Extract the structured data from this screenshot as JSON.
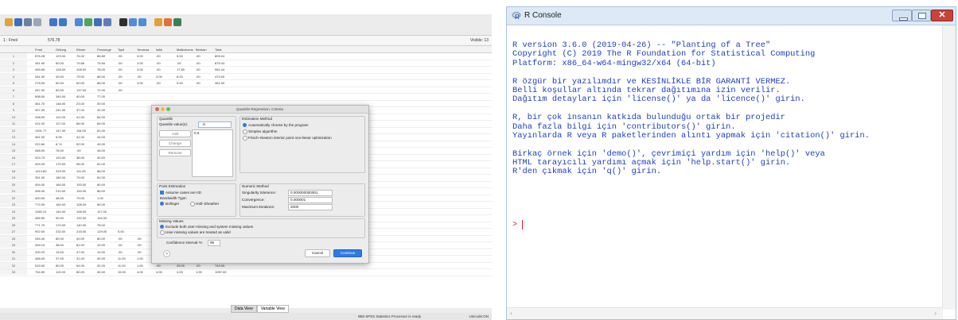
{
  "spss": {
    "cell_ref": "1 : Fmol",
    "cell_value": "576.78",
    "visible_label": "Visible: 13",
    "columns": [
      "Fmol",
      "Ortlong",
      "Ekmer",
      "Ferculuge",
      "Topli",
      "Yenucsa",
      "Isikk",
      "Matkohoms",
      "Benkan",
      "Total"
    ],
    "rows": [
      [
        "1",
        "576.28",
        "129.94",
        "76.02",
        "86.80",
        ".00",
        "3.00",
        ".00",
        "5.00",
        ".00",
        "805.04"
      ],
      [
        "2",
        "451.90",
        "60.00",
        "79.86",
        "75.84",
        ".00",
        "3.00",
        ".00",
        ".00",
        ".00",
        "875.44"
      ],
      [
        "3",
        "459.65",
        "128.00",
        "108.00",
        "78.00",
        ".00",
        "3.00",
        ".00",
        "17.80",
        ".00",
        "981.44"
      ],
      [
        "4",
        "261.00",
        "40.00",
        "79.00",
        "86.00",
        ".00",
        ".00",
        "3.00",
        "8.00",
        ".00",
        "473.00"
      ],
      [
        "5",
        "278.00",
        "60.00",
        "60.00",
        "68.00",
        ".00",
        "3.00",
        ".00",
        "5.00",
        ".00",
        "461.00"
      ],
      [
        "6",
        "267.00",
        "60.00",
        "137.00",
        "72.00",
        ".00",
        "",
        "",
        "",
        "",
        ""
      ],
      [
        "7",
        "598.00",
        "340.00",
        "90.00",
        "77.00",
        "",
        "",
        "",
        "",
        "",
        ""
      ],
      [
        "8",
        "361.70",
        "148.00",
        "23.00",
        "50.00",
        "",
        "",
        "",
        "",
        "",
        ""
      ],
      [
        "9",
        "307.30",
        "241.00",
        "37.00",
        "32.00",
        "",
        "",
        "",
        "",
        "",
        ""
      ],
      [
        "10",
        "438.00",
        "112.00",
        "41.00",
        "84.00",
        "",
        "",
        "",
        "",
        "",
        ""
      ],
      [
        "11",
        "411.00",
        "117.00",
        "86.00",
        "84.00",
        "",
        "",
        "",
        "",
        "",
        ""
      ],
      [
        "12",
        "1301.77",
        "147.00",
        "116.00",
        "81.00",
        "",
        "",
        "",
        "",
        "",
        ""
      ],
      [
        "13",
        "461.00",
        "6.00",
        "41.00",
        "44.00",
        "",
        "",
        "",
        "",
        "",
        ""
      ],
      [
        "14",
        "222.60",
        "6.74",
        "52.00",
        "40.00",
        "",
        "",
        "",
        "",
        "",
        ""
      ],
      [
        "15",
        "468.00",
        "78.00",
        ".00",
        "46.00",
        "",
        "",
        "",
        "",
        "",
        ""
      ],
      [
        "16",
        "324.70",
        "120.00",
        "38.00",
        "40.00",
        "",
        "",
        "",
        "",
        "",
        ""
      ],
      [
        "17",
        "409.25",
        "170.00",
        "96.00",
        "81.00",
        "",
        "",
        "",
        "",
        "",
        ""
      ],
      [
        "18",
        "1414.80",
        "319.00",
        "111.00",
        "88.00",
        "",
        "",
        "",
        "",
        "",
        ""
      ],
      [
        "19",
        "351.00",
        "180.00",
        "79.00",
        "81.00",
        "",
        "",
        "",
        "",
        "",
        ""
      ],
      [
        "20",
        "454.00",
        "160.00",
        "193.00",
        "80.00",
        "",
        "",
        "",
        "",
        "",
        ""
      ],
      [
        "21",
        "396.40",
        "210.00",
        "100.00",
        "86.00",
        "",
        "",
        "",
        "",
        "",
        ""
      ],
      [
        "22",
        "400.00",
        "48.00",
        "79.00",
        "1.00",
        "",
        "",
        "",
        "",
        "",
        ""
      ],
      [
        "23",
        "772.00",
        "160.00",
        "108.00",
        "80.00",
        "",
        "",
        "",
        "",
        "",
        ""
      ],
      [
        "24",
        "1158.10",
        "140.00",
        "106.00",
        "117.00",
        "",
        "",
        "",
        "",
        "",
        ""
      ],
      [
        "25",
        "485.50",
        "90.00",
        "132.00",
        "104.00",
        "",
        "",
        "",
        "",
        "",
        ""
      ],
      [
        "26",
        "771.70",
        "170.00",
        "140.00",
        "75.00",
        "",
        "",
        "",
        "",
        "",
        ""
      ],
      [
        "27",
        "902.00",
        "232.00",
        "215.00",
        "129.00",
        "5.00",
        "",
        "",
        "",
        "",
        "963.00"
      ],
      [
        "28",
        "345.40",
        "80.00",
        "40.00",
        "80.00",
        ".00",
        ".00",
        ".00",
        "4.00",
        ".00",
        "413.40"
      ],
      [
        "29",
        "269.10",
        "38.00",
        "81.00",
        "10.00",
        ".00",
        ".00",
        ".00",
        ".00",
        ".00",
        "448.02"
      ],
      [
        "30",
        "200.20",
        "13.00",
        "47.00",
        "10.00",
        ".00",
        ".00",
        ".00",
        "40.00",
        ".00",
        "341.20"
      ],
      [
        "31",
        "468.00",
        "37.00",
        "31.00",
        "40.00",
        "11.00",
        "1.00",
        ".00",
        ".00",
        ".00",
        "581.20"
      ],
      [
        "32",
        "515.00",
        "80.00",
        "54.00",
        "52.00",
        "11.00",
        "1.00",
        ".00",
        "25.00",
        ".00",
        "743.00"
      ],
      [
        "33",
        "754.50",
        "113.00",
        "80.00",
        "40.00",
        "15.00",
        "4.00",
        "4.00",
        "4.00",
        "1.00",
        "1057.00"
      ]
    ],
    "tab_data_view": "Data View",
    "tab_variable_view": "Variable View",
    "status_processor": "IBM SPSS Statistics Processor is ready",
    "status_unicode": "Unicode:ON",
    "dialog": {
      "title": "Quantile Regression: Criteria",
      "quantile_group": "Quantile",
      "quantile_values_label": "Quantile value(s):",
      "quantile_value": ".5",
      "add_label": "Add",
      "change_label": "Change",
      "remove_label": "Remove",
      "list_value": "0.5",
      "estimation_group": "Estimation Method",
      "est_auto": "Automatically choose by the program",
      "est_simplex": "Simplex algorithm",
      "est_frisch": "Frisch–Newton interior point non-linear optimization",
      "point_group": "Point Estimation",
      "assume_iid": "Assume cases are IID",
      "bandwidth_label": "Bandwidth Type:",
      "bw_bofinger": "Bofinger",
      "bw_hall": "Hall–Sheather",
      "numeric_group": "Numeric Method",
      "singularity_label": "Singularity tolerance:",
      "singularity_value": "0.000000000001",
      "convergence_label": "Convergence:",
      "convergence_value": "0.000001",
      "max_iter_label": "Maximum iterations:",
      "max_iter_value": "2000",
      "missing_group": "Missing Values",
      "missing_exclude": "Exclude both user-missing and system missing values",
      "missing_valid": "User-missing values are treated as valid",
      "ci_label": "Confidence interval %:",
      "ci_value": "95",
      "help_label": "?",
      "cancel_label": "Cancel",
      "continue_label": "Continue"
    }
  },
  "rconsole": {
    "title": "R Console",
    "lines": [
      "R version 3.6.0 (2019-04-26) -- \"Planting of a Tree\"",
      "Copyright (C) 2019 The R Foundation for Statistical Computing",
      "Platform: x86_64-w64-mingw32/x64 (64-bit)",
      "",
      "R özgür bir yazılımdır ve KESİNLİKLE BİR GARANTİ VERMEZ.",
      "Belli koşullar altında tekrar dağıtımına izin verilir.",
      "Dağıtım detayları için 'license()' ya da 'licence()' girin.",
      "",
      "R, bir çok insanın katkıda bulunduğu ortak bir projedir",
      "Daha fazla bilgi için 'contributors()' girin.",
      "Yayınlarda R veya R paketlerinden alıntı yapmak için 'citation()' girin.",
      "",
      "Birkaç örnek için 'demo()', çevrimiçi yardım için 'help()' veya",
      "HTML tarayıcılı yardımı açmak için 'help.start()' girin.",
      "R'den çıkmak için 'q()' girin."
    ],
    "prompt": ">"
  }
}
